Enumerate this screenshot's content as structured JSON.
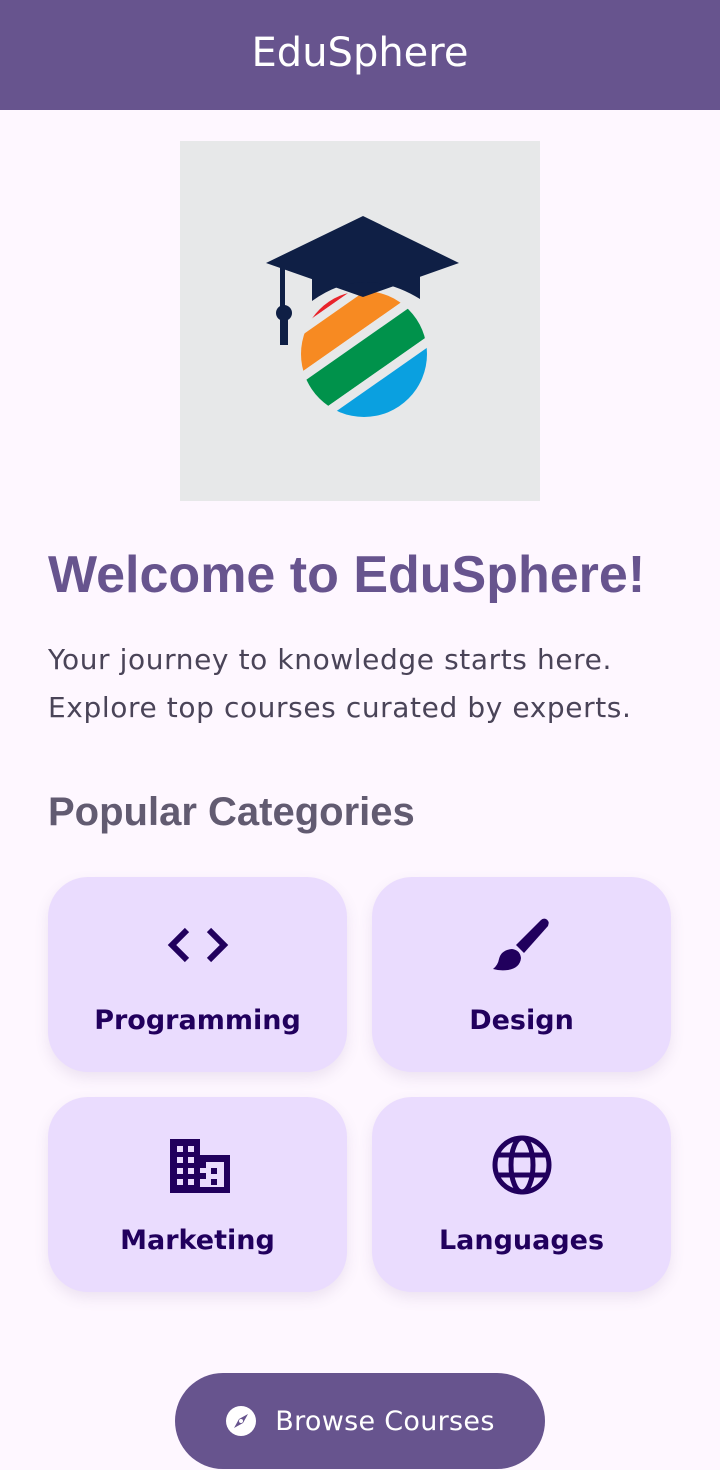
{
  "app_bar": {
    "title": "EduSphere"
  },
  "hero": {
    "logo_icon": "graduation-cap-globe-logo",
    "colors": {
      "background": "#e7e8e9",
      "cap": "#0f1f45",
      "red": "#e8232b",
      "orange": "#f78a22",
      "green": "#00924b",
      "blue": "#0aa0e0"
    }
  },
  "welcome": {
    "heading": "Welcome to EduSphere!",
    "line1": "Your journey to knowledge starts here.",
    "line2": "Explore top courses curated by experts."
  },
  "categories": {
    "title": "Popular Categories",
    "items": [
      {
        "label": "Programming",
        "icon": "code-icon"
      },
      {
        "label": "Design",
        "icon": "brush-icon"
      },
      {
        "label": "Marketing",
        "icon": "business-icon"
      },
      {
        "label": "Languages",
        "icon": "globe-icon"
      }
    ]
  },
  "cta": {
    "label": "Browse Courses",
    "icon": "explore-compass-icon"
  },
  "colors": {
    "primary": "#67548e",
    "background": "#fef7ff",
    "card": "#eadcfe",
    "on_card": "#21005d",
    "body_text": "#4a4458",
    "section_title": "#625b71"
  }
}
